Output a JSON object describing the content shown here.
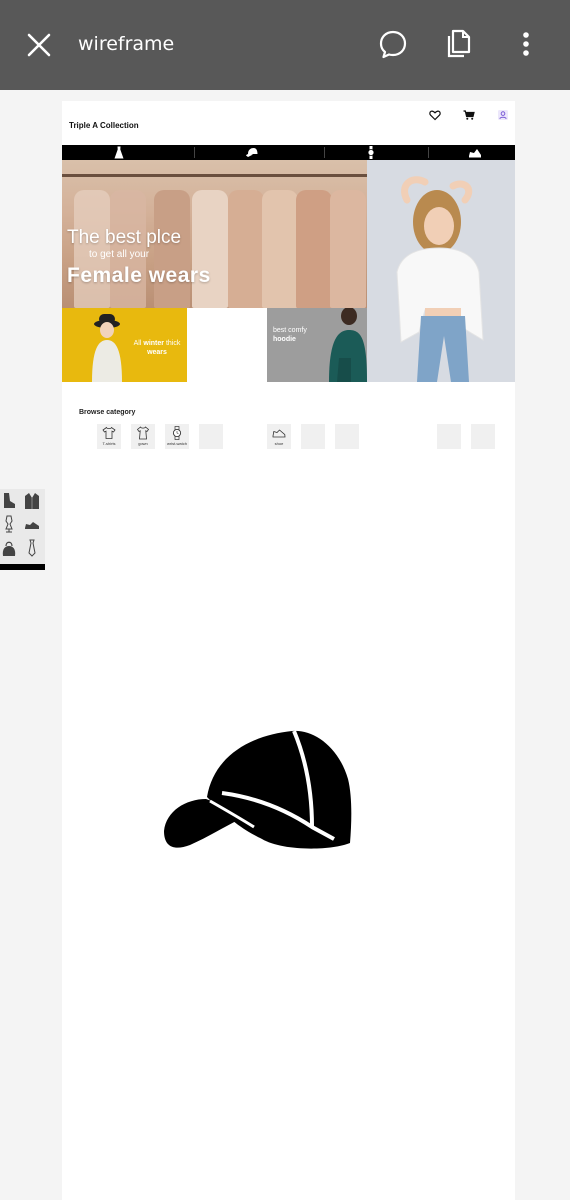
{
  "app_bar": {
    "title": "wireframe",
    "icons": [
      "close-icon",
      "comment-icon",
      "copy-icon",
      "more-vert-icon"
    ]
  },
  "site": {
    "brand": "Triple A Collection",
    "header_icons": [
      "heart-icon",
      "cart-icon",
      "user-icon"
    ],
    "category_bar_icons": [
      "dress-icon",
      "cap-icon",
      "wristwatch-icon",
      "sneaker-icon"
    ]
  },
  "hero": {
    "line1": "The best plce",
    "line2": "to get all your",
    "line3": "Female wears"
  },
  "promos": {
    "winter_prefix": "All",
    "winter_bold": "winter",
    "winter_suffix": "thick",
    "winter_line2": "wears",
    "hoodie_line1": "best comfy",
    "hoodie_line2": "hoodie"
  },
  "browse": {
    "heading": "Browse category",
    "categories": [
      {
        "label": "T-shirts",
        "icon": "tshirt-icon"
      },
      {
        "label": "gown",
        "icon": "gown-icon"
      },
      {
        "label": "wrist-watch",
        "icon": "wristwatch-icon"
      },
      {
        "label": "",
        "icon": ""
      },
      {
        "label": "shoe",
        "icon": "shoe-icon"
      },
      {
        "label": "",
        "icon": ""
      },
      {
        "label": "",
        "icon": ""
      },
      {
        "label": "",
        "icon": ""
      },
      {
        "label": "",
        "icon": ""
      }
    ]
  },
  "colors": {
    "app_bar": "#585858",
    "winter_tile": "#e8b90e",
    "category_bar": "#000000",
    "user_icon": "#7b5cd6"
  }
}
